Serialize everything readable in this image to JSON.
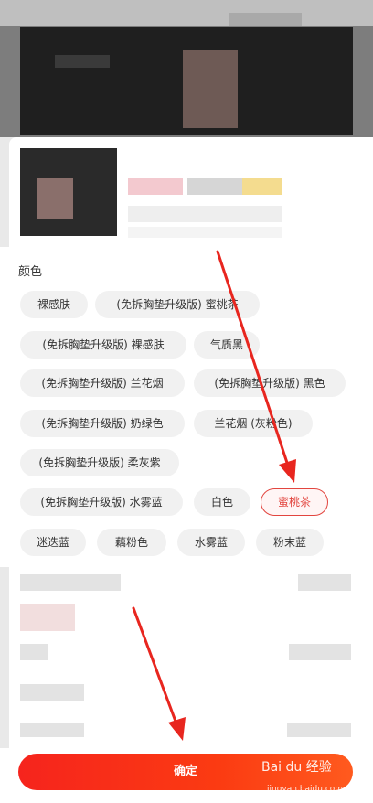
{
  "colors": {
    "accent": "#e2453f",
    "button_gradient_start": "#f6241d",
    "button_gradient_end": "#ff5a1e",
    "chip_bg": "#f1f1f1"
  },
  "section": {
    "title": "颜色"
  },
  "options": [
    {
      "label": "裸感肤",
      "selected": false
    },
    {
      "label": "(免拆胸垫升级版) 蜜桃茶",
      "selected": false
    },
    {
      "label": "(免拆胸垫升级版) 裸感肤",
      "selected": false
    },
    {
      "label": "气质黑",
      "selected": false
    },
    {
      "label": "(免拆胸垫升级版) 兰花烟",
      "selected": false
    },
    {
      "label": "(免拆胸垫升级版) 黑色",
      "selected": false
    },
    {
      "label": "(免拆胸垫升级版) 奶绿色",
      "selected": false
    },
    {
      "label": "兰花烟 (灰粉色)",
      "selected": false
    },
    {
      "label": "(免拆胸垫升级版) 柔灰紫",
      "selected": false
    },
    {
      "label": "(免拆胸垫升级版) 水雾蓝",
      "selected": false
    },
    {
      "label": "白色",
      "selected": false
    },
    {
      "label": "蜜桃茶",
      "selected": true
    },
    {
      "label": "迷迭蓝",
      "selected": false
    },
    {
      "label": "藕粉色",
      "selected": false
    },
    {
      "label": "水雾蓝",
      "selected": false
    },
    {
      "label": "粉末蓝",
      "selected": false
    }
  ],
  "confirm": {
    "label": "确定"
  },
  "watermark": {
    "brand": "Bai du 经验",
    "url": "jingyan.baidu.com"
  }
}
